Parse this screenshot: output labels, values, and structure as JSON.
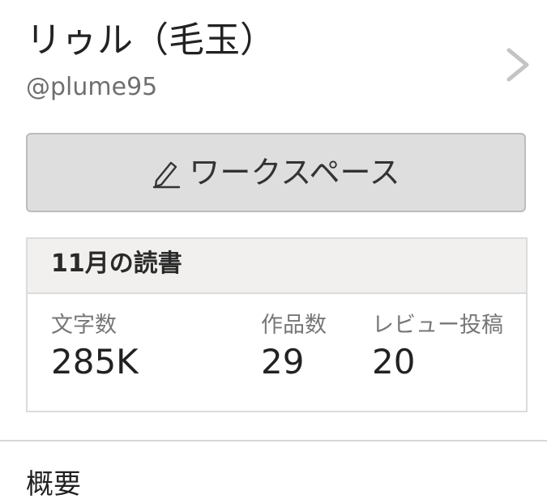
{
  "profile": {
    "name": "リゥル（毛玉）",
    "handle": "@plume95",
    "chevron_icon": "chevron-right-icon"
  },
  "workspace_button": {
    "icon": "pencil-icon",
    "label": "ワークスペース"
  },
  "monthly_reading": {
    "title": "11月の読書",
    "stats": [
      {
        "label": "文字数",
        "value": "285K"
      },
      {
        "label": "作品数",
        "value": "29"
      },
      {
        "label": "レビュー投稿",
        "value": "20"
      }
    ]
  },
  "overview": {
    "title": "概要"
  }
}
